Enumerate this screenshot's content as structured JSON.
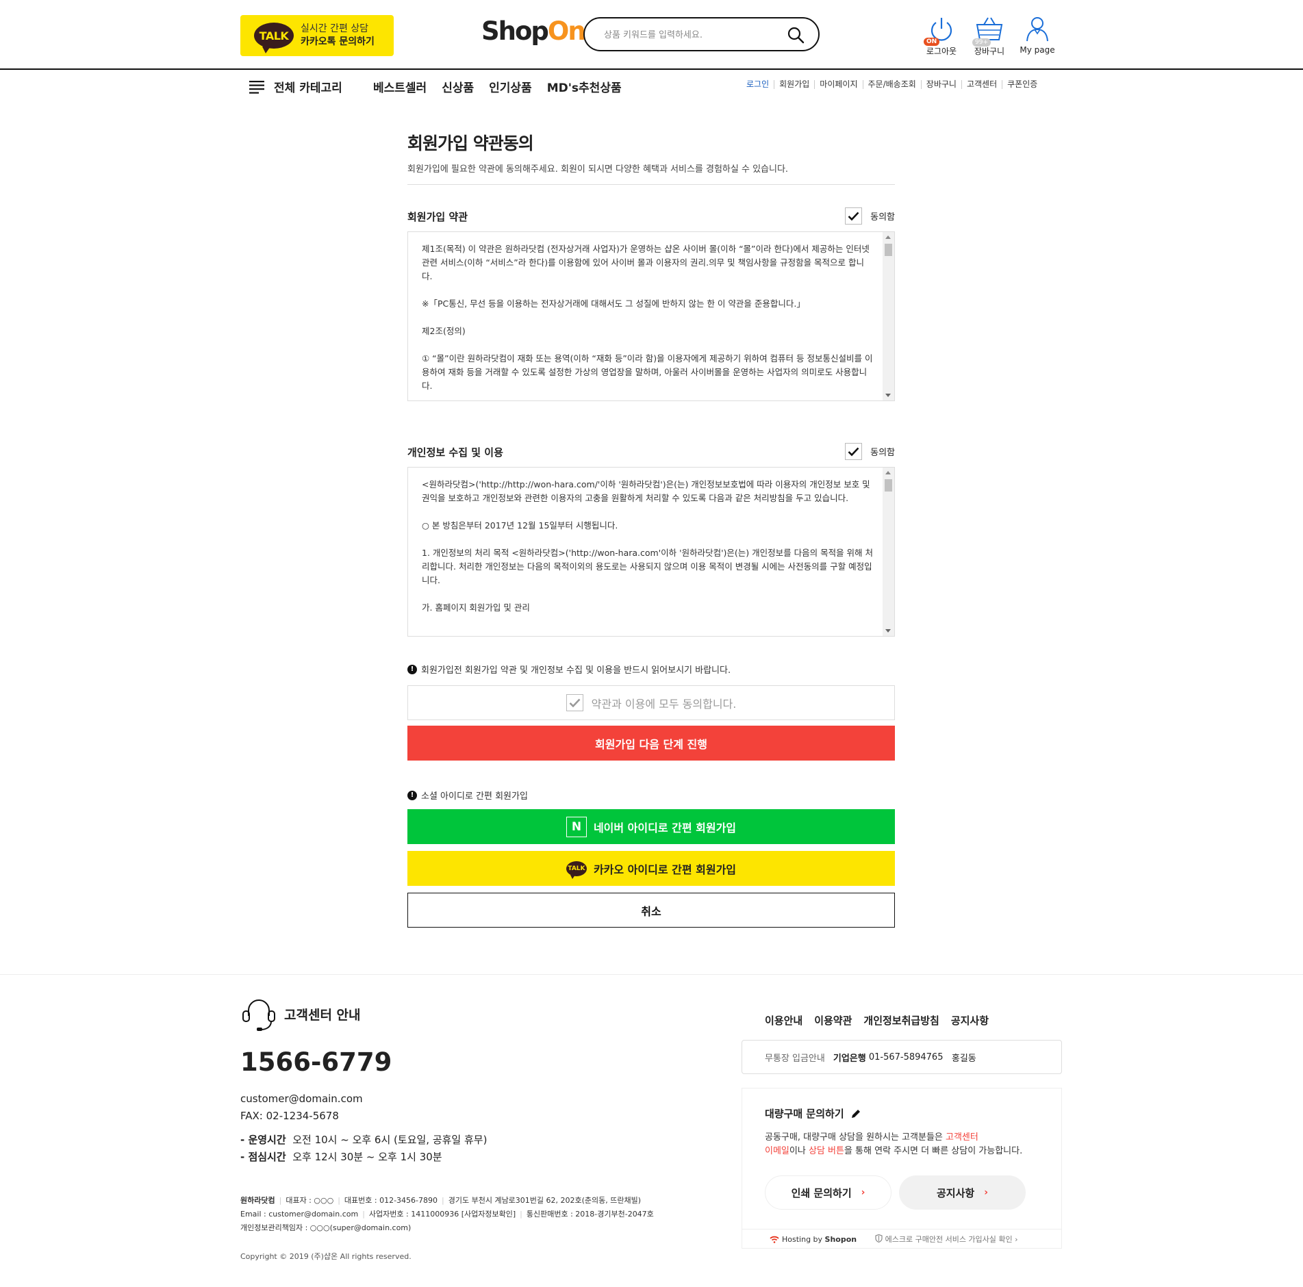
{
  "header": {
    "kakao_line1": "실시간 간편 상담",
    "kakao_line2": "카카오톡 문의하기",
    "talk_badge": "TALK",
    "logo_shop": "Shop",
    "logo_on": "On",
    "search_placeholder": "상품 키워드를 입력하세요.",
    "util": {
      "logout": "로그아웃",
      "logout_badge": "ON",
      "cart": "장바구니",
      "cart_badge": "99+",
      "mypage": "My page"
    }
  },
  "nav": {
    "all_category": "전체 카테고리",
    "main": [
      "베스트셀러",
      "신상품",
      "인기상품",
      "MD's추천상품"
    ],
    "sub": [
      "로그인",
      "회원가입",
      "마이페이지",
      "주문/배송조회",
      "장바구니",
      "고객센터",
      "쿠폰인증"
    ]
  },
  "page": {
    "title": "회원가입 약관동의",
    "desc": "회원가입에 필요한 약관에 동의해주세요. 회원이 되시면 다양한 혜택과 서비스를 경험하실 수 있습니다."
  },
  "terms": {
    "title": "회원가입 약관",
    "agree_label": "동의함",
    "paragraphs": [
      "제1조(목적) 이 약관은 원하라닷컴 (전자상거래 사업자)가 운영하는 샵온 사이버 몰(이하 “몰”이라 한다)에서 제공하는 인터넷 관련 서비스(이하 “서비스”라 한다)를 이용함에 있어 사이버 몰과 이용자의 권리․의무 및 책임사항을 규정함을 목적으로 합니다.",
      "※「PC통신, 무선 등을 이용하는 전자상거래에 대해서도 그 성질에 반하지 않는 한 이 약관을 준용합니다.」",
      "제2조(정의)",
      "① “몰”이란 원하라닷컴이 재화 또는 용역(이하 “재화 등”이라 함)을 이용자에게 제공하기 위하여 컴퓨터 등 정보통신설비를 이용하여 재화 등을 거래할 수 있도록 설정한 가상의 영업장을 말하며, 아울러 사이버몰을 운영하는 사업자의 의미로도 사용합니다."
    ]
  },
  "privacy": {
    "title": "개인정보 수집 및 이용",
    "agree_label": "동의함",
    "paragraphs": [
      "<원하라닷컴>('http://http://won-hara.com/'이하 '원하라닷컴')은(는) 개인정보보호법에 따라 이용자의 개인정보 보호 및 권익을 보호하고 개인정보와 관련한 이용자의 고충을 원활하게 처리할 수 있도록 다음과 같은 처리방침을 두고 있습니다.",
      "○ 본 방침은부터 2017년 12월 15일부터 시행됩니다.",
      "1. 개인정보의 처리 목적 <원하라닷컴>('http://won-hara.com'이하 '원하라닷컴')은(는) 개인정보를 다음의 목적을 위해 처리합니다. 처리한 개인정보는 다음의 목적이외의 용도로는 사용되지 않으며 이용 목적이 변경될 시에는 사전동의를 구할 예정입니다.",
      "가. 홈페이지 회원가입 및 관리"
    ]
  },
  "notice_text": "회원가입전 회원가입 약관 및 개인정보 수집 및 이용을 반드시 읽어보시기 바랍니다.",
  "all_agree_label": "약관과 이용에 모두 동의합니다.",
  "next_button": "회원가입 다음 단계 진행",
  "social": {
    "notice": "소셜 아이디로 간편 회원가입",
    "naver_icon_text": "N",
    "naver": "네이버 아이디로 간편 회원가입",
    "kakao_icon_text": "TALK",
    "kakao": "카카오 아이디로 간편 회원가입"
  },
  "cancel_button": "취소",
  "footer": {
    "cs_title": "고객센터 안내",
    "phone": "1566-6779",
    "email": "customer@domain.com",
    "fax": "FAX: 02-1234-5678",
    "hours_label": "- 운영시간",
    "hours_value": "오전 10시 ~ 오후 6시 (토요일, 공휴일 휴무)",
    "lunch_label": "- 점심시간",
    "lunch_value": "오후 12시 30분 ~ 오후 1시 30분",
    "company_line1": [
      "원하라닷컴",
      "대표자 : ○○○",
      "대표번호 : 012-3456-7890",
      "경기도 부천시 계남로301번길 62, 202호(춘의동, 뜨란채빌)"
    ],
    "company_line2": [
      "Email : customer@domain.com",
      "사업자번호 : 1411000936 [사업자정보확인]",
      "통신판매번호 : 2018-경기부천-2047호"
    ],
    "company_line3": "개인정보관리책임자 : ○○○(super@domain.com)",
    "copyright": "Copyright © 2019 (주)샵온 All rights reserved.",
    "links": [
      "이용안내",
      "이용약관",
      "개인정보취급방침",
      "공지사항"
    ],
    "bank_label": "무통장 입금안내",
    "bank_name": "기업은행",
    "bank_account": "01-567-5894765",
    "bank_holder": "홍길동",
    "bulk_title": "대량구매 문의하기",
    "bulk_desc_1": "공동구매, 대량구매 상담을 원하시는 고객분들은 ",
    "bulk_desc_red1": "고객센터",
    "bulk_desc_red2": "이메일",
    "bulk_desc_2": "이나 ",
    "bulk_desc_red3": "상담 버튼",
    "bulk_desc_3": "을 통해 연락 주시면 더 빠른 상담이 가능합니다.",
    "pill_1": "인쇄 문의하기",
    "pill_2": "공지사항",
    "hosting_by": "Hosting by",
    "hosting_name": "Shopon",
    "escrow": "에스크로 구매안전 서비스 가입사실 확인"
  },
  "colors": {
    "kakao_yellow": "#fde500",
    "naver_green": "#00c53b",
    "primary_red": "#f3423a",
    "logo_orange": "#f7931e",
    "nav_active_blue": "#1a5fbf"
  }
}
